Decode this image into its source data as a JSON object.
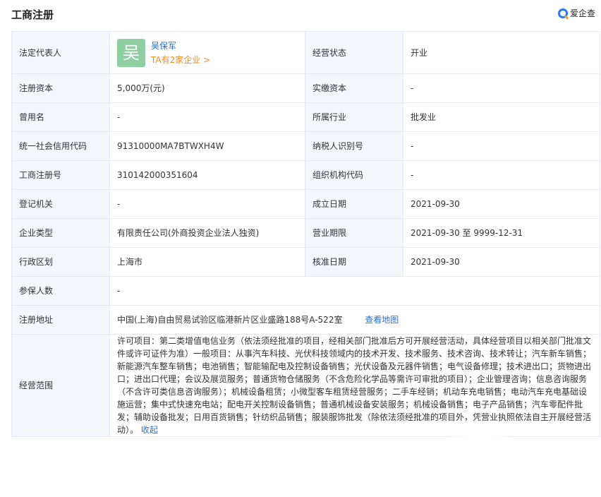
{
  "header": {
    "title": "工商注册",
    "brand": "爱企查"
  },
  "legal_rep": {
    "label": "法定代表人",
    "avatar_char": "吴",
    "name": "吴保军",
    "company_link": "TA有2家企业 >"
  },
  "rows": [
    {
      "l1": "法定代表人",
      "v1": "",
      "l2": "经营状态",
      "v2": "开业"
    },
    {
      "l1": "注册资本",
      "v1": "5,000万(元)",
      "l2": "实缴资本",
      "v2": "-"
    },
    {
      "l1": "曾用名",
      "v1": "-",
      "l2": "所属行业",
      "v2": "批发业"
    },
    {
      "l1": "统一社会信用代码",
      "v1": "91310000MA7BTWXH4W",
      "l2": "纳税人识别号",
      "v2": "-"
    },
    {
      "l1": "工商注册号",
      "v1": "310142000351604",
      "l2": "组织机构代码",
      "v2": "-"
    },
    {
      "l1": "登记机关",
      "v1": "-",
      "l2": "成立日期",
      "v2": "2021-09-30"
    },
    {
      "l1": "企业类型",
      "v1": "有限责任公司(外商投资企业法人独资)",
      "l2": "营业期限",
      "v2": "2021-09-30 至 9999-12-31"
    },
    {
      "l1": "行政区划",
      "v1": "上海市",
      "l2": "核准日期",
      "v2": "2021-09-30"
    }
  ],
  "insured": {
    "label": "参保人数",
    "value": "-"
  },
  "address": {
    "label": "注册地址",
    "value": "中国(上海)自由贸易试验区临港新片区业盛路188号A-522室",
    "map_link": "查看地图"
  },
  "scope": {
    "label": "经营范围",
    "text": "许可项目：第二类增值电信业务（依法须经批准的项目，经相关部门批准后方可开展经营活动，具体经营项目以相关部门批准文件或许可证件为准）一般项目：从事汽车科技、光伏科技领域内的技术开发、技术服务、技术咨询、技术转让；汽车新车销售；新能源汽车整车销售；电池销售；智能输配电及控制设备销售；光伏设备及元器件销售；电气设备修理；技术进出口；货物进出口；进出口代理；会议及展览服务；普通货物仓储服务（不含危险化学品等需许可审批的项目）；企业管理咨询；信息咨询服务（不含许可类信息咨询服务）；机械设备租赁；小微型客车租赁经营服务；二手车经销；机动车充电销售；电动汽车充电基础设施运营；集中式快速充电站；配电开关控制设备销售；普通机械设备安装服务；机械设备销售；电子产品销售；汽车零配件批发；辅助设备批发；日用百货销售；针纺织品销售；服装服饰批发（除依法须经批准的项目外，凭营业执照依法自主开展经营活动）。",
    "collapse_link": "收起"
  }
}
